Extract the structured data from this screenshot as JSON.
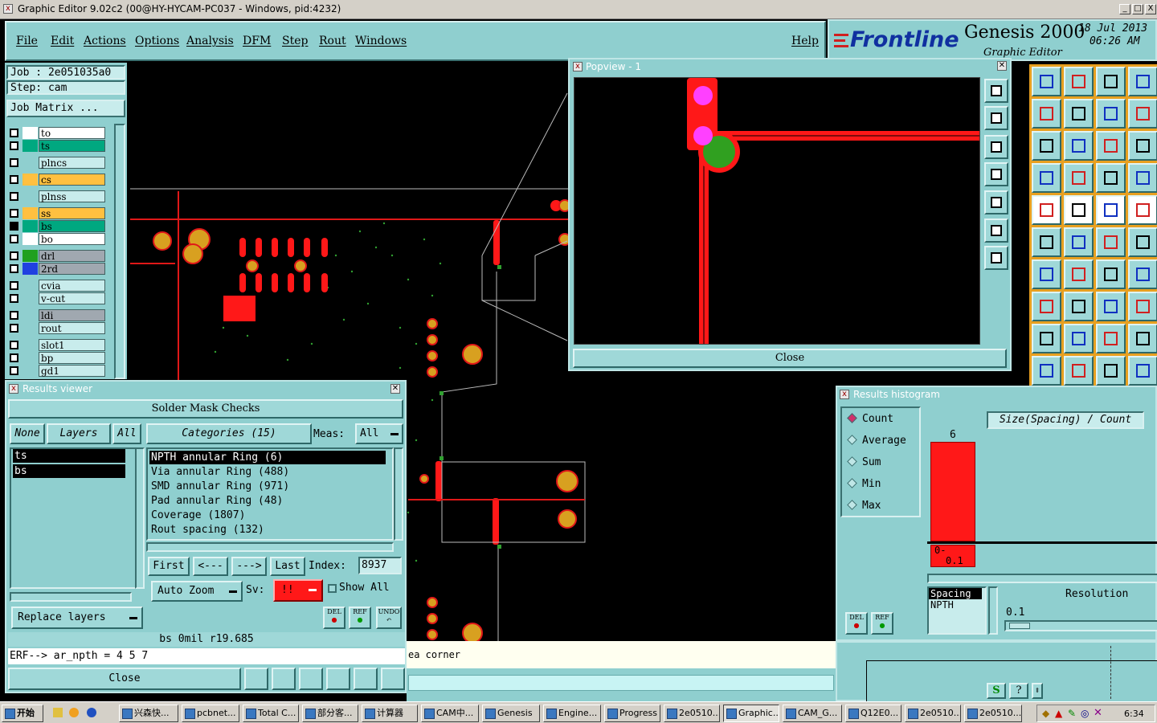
{
  "window": {
    "title": "Graphic Editor 9.02c2 (00@HY-HYCAM-PC037 - Windows, pid:4232)",
    "min": "_",
    "max": "□",
    "close": "X"
  },
  "menu": {
    "items": [
      "File",
      "Edit",
      "Actions",
      "Options",
      "Analysis",
      "DFM",
      "Step",
      "Rout",
      "Windows"
    ],
    "help": "Help"
  },
  "brand": {
    "logo": "Frontline",
    "product": "Genesis 2000",
    "subtitle": "Graphic Editor",
    "date": "18 Jul 2013",
    "time": "06:26 AM"
  },
  "job": {
    "job_label": "Job : 2e051035a0",
    "step_label": "Step: cam",
    "matrix_button": "Job Matrix ..."
  },
  "layers": [
    {
      "name": "to",
      "color": "#ffffff",
      "bg": "#ffffff"
    },
    {
      "name": "ts",
      "color": "#00a880",
      "bg": "#00a880"
    },
    {
      "name": "plncs",
      "color": "#8fcfcf",
      "bg": "#c8ecec"
    },
    {
      "name": "cs",
      "color": "#ffc040",
      "bg": "#ffc040"
    },
    {
      "name": "plnss",
      "color": "#8fcfcf",
      "bg": "#c8ecec"
    },
    {
      "name": "ss",
      "color": "#ffc040",
      "bg": "#ffc040"
    },
    {
      "name": "bs",
      "color": "#00a880",
      "bg": "#00a880"
    },
    {
      "name": "bo",
      "color": "#ffffff",
      "bg": "#ffffff"
    },
    {
      "name": "drl",
      "color": "#20a020",
      "bg": "#a0a8b0"
    },
    {
      "name": "2rd",
      "color": "#2040e0",
      "bg": "#a0a8b0"
    },
    {
      "name": "cvia",
      "color": "#8fcfcf",
      "bg": "#c8ecec"
    },
    {
      "name": "v-cut",
      "color": "#8fcfcf",
      "bg": "#c8ecec"
    },
    {
      "name": "ldi",
      "color": "#8fcfcf",
      "bg": "#a0a8b0"
    },
    {
      "name": "rout",
      "color": "#8fcfcf",
      "bg": "#c8ecec"
    },
    {
      "name": "slot1",
      "color": "#8fcfcf",
      "bg": "#c8ecec"
    },
    {
      "name": "bp",
      "color": "#8fcfcf",
      "bg": "#c8ecec"
    },
    {
      "name": "gd1",
      "color": "#8fcfcf",
      "bg": "#c8ecec"
    }
  ],
  "popview": {
    "title": "Popview - 1",
    "close_button": "Close"
  },
  "results_viewer": {
    "title": "Results viewer",
    "header": "Solder Mask Checks",
    "none_button": "None",
    "layers_button": "Layers",
    "all_button": "All",
    "layer_list": [
      "ts",
      "bs"
    ],
    "categories_button": "Categories (15)",
    "meas_label": "Meas:",
    "meas_value": "All",
    "categories": [
      "NPTH annular Ring (6)",
      "Via annular Ring (488)",
      "SMD annular Ring (971)",
      "Pad annular Ring (48)",
      "Coverage (1807)",
      "Rout spacing (132)"
    ],
    "first_button": "First",
    "prev_button": "<---",
    "next_button": "--->",
    "last_button": "Last",
    "index_label": "Index:",
    "index_value": "8937",
    "autozoom_button": "Auto Zoom",
    "sv_label": "Sv:",
    "sv_value": "!!",
    "show_all_label": "Show All",
    "del_label": "DEL",
    "ref_label": "REF",
    "undo_label": "UNDO",
    "replace_layers_button": "Replace layers",
    "info_line": "bs 0mil   r19.685",
    "erf_line": "ERF--> ar_npth = 4 5 7",
    "close_button": "Close"
  },
  "histogram": {
    "title": "Results histogram",
    "modes": [
      "Count",
      "Average",
      "Sum",
      "Min",
      "Max"
    ],
    "selected_mode": "Count",
    "axis_title": "Size(Spacing) / Count",
    "bar_label": "6",
    "bin_label_1": "0-",
    "bin_label_2": "0.1",
    "param_label_1": "Spacing",
    "param_label_2": "NPTH",
    "resolution_label": "Resolution",
    "resolution_value": "0.1",
    "del_label": "DEL",
    "ref_label": "REF"
  },
  "status": {
    "text": "ea corner"
  },
  "taskbar": {
    "start": "开始",
    "items": [
      "兴森快...",
      "pcbnet...",
      "Total C...",
      "部分客...",
      "计算器",
      "CAM中...",
      "Genesis",
      "Engine...",
      "Progress",
      "2e0510...",
      "Graphic...",
      "CAM_G...",
      "Q12E0...",
      "2e0510...",
      "2e0510..."
    ],
    "active_index": 10,
    "clock": "6:34"
  }
}
